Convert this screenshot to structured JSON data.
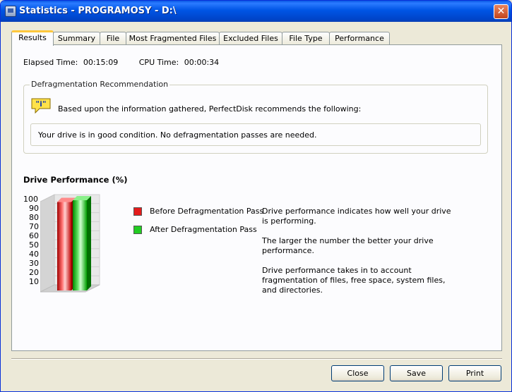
{
  "window": {
    "title": "Statistics - PROGRAMOSY - D:\\",
    "close_glyph": "✕"
  },
  "tabs": [
    {
      "label": "Results",
      "active": true
    },
    {
      "label": "Summary"
    },
    {
      "label": "File"
    },
    {
      "label": "Most Fragmented Files"
    },
    {
      "label": "Excluded Files"
    },
    {
      "label": "File Type"
    },
    {
      "label": "Performance"
    }
  ],
  "times": {
    "elapsed_label": "Elapsed Time:",
    "elapsed_value": "00:15:09",
    "cpu_label": "CPU Time:",
    "cpu_value": "00:00:34"
  },
  "recommendation": {
    "group_label": "Defragmentation Recommendation",
    "icon": "info-icon",
    "icon_glyph": "\"i\"",
    "intro": "Based upon the information gathered, PerfectDisk recommends the following:",
    "status": "Your drive is in good condition.  No defragmentation passes are needed."
  },
  "chart_data": {
    "type": "bar",
    "title": "Drive Performance (%)",
    "categories": [
      "Before Defragmentation Pass",
      "After Defragmentation Pass"
    ],
    "values": [
      98,
      100
    ],
    "colors": [
      "#e00000",
      "#00b000"
    ],
    "ylim": [
      0,
      100
    ],
    "yticks": [
      "100",
      "90",
      "80",
      "70",
      "60",
      "50",
      "40",
      "30",
      "20",
      "10"
    ],
    "legend_placement": "right"
  },
  "legend": [
    {
      "label": "Before Defragmentation Pass",
      "color": "#e41b1b"
    },
    {
      "label": "After Defragmentation Pass",
      "color": "#22cc22"
    }
  ],
  "description": [
    "Drive performance indicates how well your drive is performing.",
    "The larger the number the better your drive performance.",
    "Drive performance takes in to account fragmentation of files, free space, system files, and directories."
  ],
  "buttons": {
    "close": "Close",
    "save": "Save",
    "print": "Print"
  }
}
